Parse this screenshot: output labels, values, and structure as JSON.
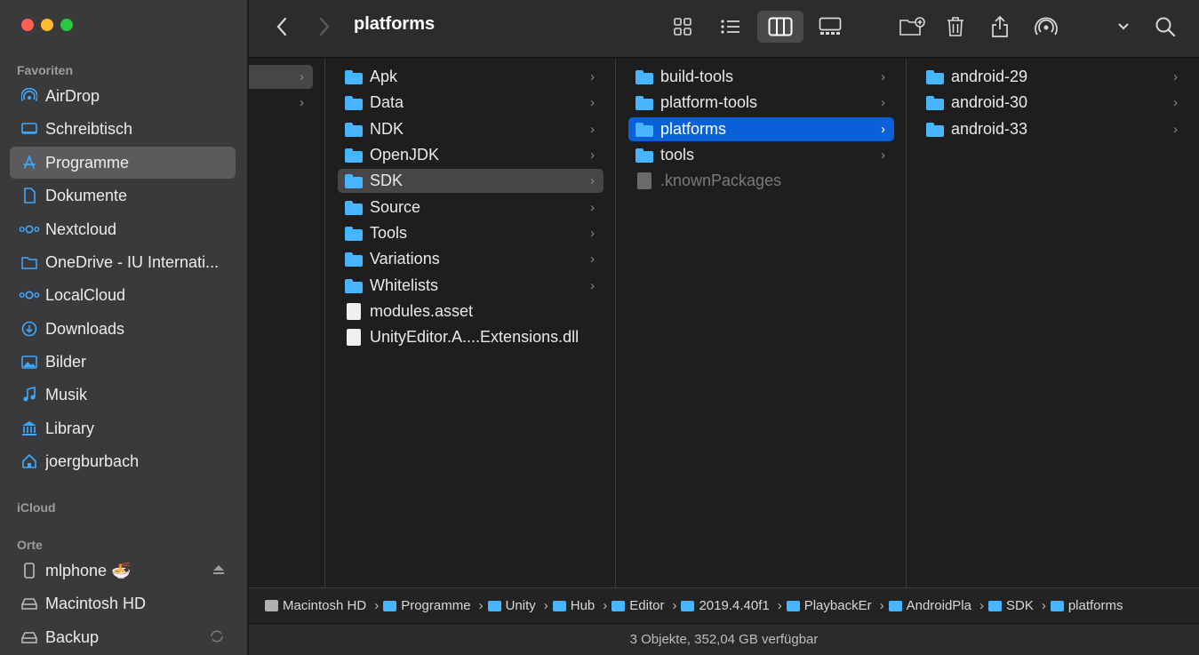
{
  "window": {
    "title": "platforms"
  },
  "sidebar": {
    "sections": {
      "favorites": "Favoriten",
      "icloud": "iCloud",
      "locations": "Orte"
    },
    "favorites": [
      {
        "label": "AirDrop",
        "icon": "airdrop-icon"
      },
      {
        "label": "Schreibtisch",
        "icon": "desktop-icon"
      },
      {
        "label": "Programme",
        "icon": "applications-icon",
        "selected": true
      },
      {
        "label": "Dokumente",
        "icon": "document-icon"
      },
      {
        "label": "Nextcloud",
        "icon": "nextcloud-icon"
      },
      {
        "label": "OneDrive - IU Internati...",
        "icon": "folder-outline-icon"
      },
      {
        "label": "LocalCloud",
        "icon": "nextcloud-icon"
      },
      {
        "label": "Downloads",
        "icon": "download-icon"
      },
      {
        "label": "Bilder",
        "icon": "photos-icon"
      },
      {
        "label": "Musik",
        "icon": "music-icon"
      },
      {
        "label": "Library",
        "icon": "library-icon"
      },
      {
        "label": "joergburbach",
        "icon": "home-icon"
      }
    ],
    "locations": [
      {
        "label": "mlphone 🍜",
        "icon": "phone-icon",
        "trailing": "eject-icon"
      },
      {
        "label": "Macintosh HD",
        "icon": "disk-icon"
      },
      {
        "label": "Backup",
        "icon": "disk-icon",
        "trailing": "sync-icon"
      }
    ]
  },
  "columns": {
    "col2": [
      {
        "label": "Apk",
        "type": "folder"
      },
      {
        "label": "Data",
        "type": "folder"
      },
      {
        "label": "NDK",
        "type": "folder"
      },
      {
        "label": "OpenJDK",
        "type": "folder"
      },
      {
        "label": "SDK",
        "type": "folder",
        "selected": "gray"
      },
      {
        "label": "Source",
        "type": "folder"
      },
      {
        "label": "Tools",
        "type": "folder"
      },
      {
        "label": "Variations",
        "type": "folder"
      },
      {
        "label": "Whitelists",
        "type": "folder"
      },
      {
        "label": "modules.asset",
        "type": "file"
      },
      {
        "label": "UnityEditor.A....Extensions.dll",
        "type": "file"
      }
    ],
    "col3": [
      {
        "label": "build-tools",
        "type": "folder"
      },
      {
        "label": "platform-tools",
        "type": "folder"
      },
      {
        "label": "platforms",
        "type": "folder",
        "selected": "blue"
      },
      {
        "label": "tools",
        "type": "folder"
      },
      {
        "label": ".knownPackages",
        "type": "file",
        "dim": true
      }
    ],
    "col4": [
      {
        "label": "android-29",
        "type": "folder"
      },
      {
        "label": "android-30",
        "type": "folder"
      },
      {
        "label": "android-33",
        "type": "folder"
      }
    ]
  },
  "pathbar": [
    {
      "label": "Macintosh HD",
      "type": "disk"
    },
    {
      "label": "Programme",
      "type": "folder"
    },
    {
      "label": "Unity",
      "type": "folder"
    },
    {
      "label": "Hub",
      "type": "folder"
    },
    {
      "label": "Editor",
      "type": "folder"
    },
    {
      "label": "2019.4.40f1",
      "type": "folder"
    },
    {
      "label": "PlaybackEr",
      "type": "folder"
    },
    {
      "label": "AndroidPla",
      "type": "folder"
    },
    {
      "label": "SDK",
      "type": "folder"
    },
    {
      "label": "platforms",
      "type": "folder"
    }
  ],
  "status": {
    "text": "3 Objekte, 352,04 GB verfügbar"
  },
  "chevron": "›",
  "colors": {
    "accent": "#0a60d8",
    "folder": "#47b5ff",
    "sidebar_icon": "#3ea8ff"
  }
}
